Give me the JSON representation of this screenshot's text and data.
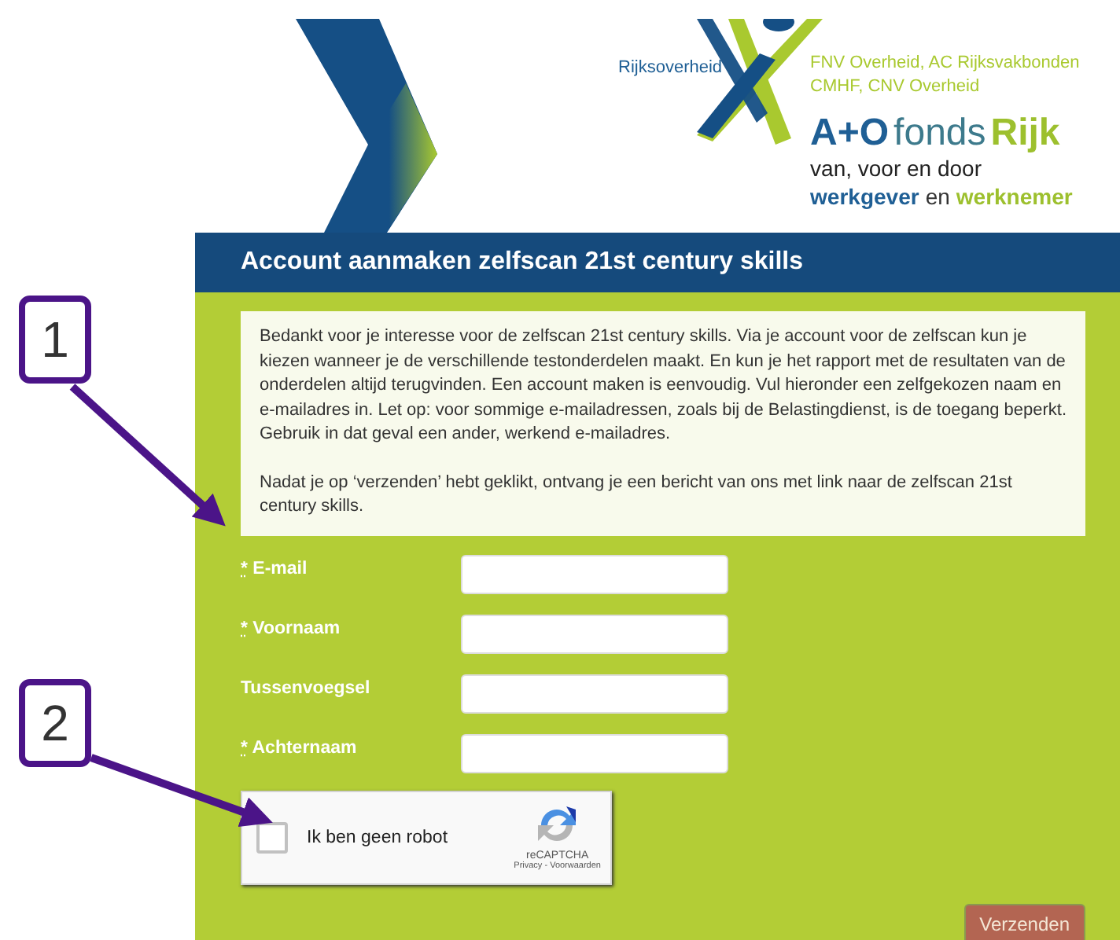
{
  "header": {
    "ministry": "Rijksoverheid",
    "unions": [
      "FNV Overheid, AC Rijksvakbonden",
      "CMHF, CNV Overheid"
    ],
    "logo_name": [
      {
        "text": "A+O",
        "color": "#1f5f95",
        "bold": true
      },
      {
        "text": "fonds",
        "color": "#3d7a8c",
        "bold": false
      },
      {
        "text": "Rijk",
        "color": "#9dc02e",
        "bold": true
      }
    ],
    "tagline": "van, voor en door",
    "tagline_2": [
      {
        "text": "werkgever",
        "color": "#1f5f95",
        "bold": true
      },
      {
        "text": "en",
        "color": "#333333",
        "bold": false
      },
      {
        "text": "werknemer",
        "color": "#9dc02e",
        "bold": true
      }
    ]
  },
  "title": "Account aanmaken zelfscan 21st century skills",
  "intro": [
    "Bedankt voor je interesse voor de zelfscan 21st century skills. Via je account voor de zelfscan kun je kiezen wanneer je de verschillende testonderdelen maakt. En kun je het rapport met de resultaten van de onderdelen altijd terugvinden. Een account maken is eenvoudig. Vul hieronder een zelfgekozen naam en e-mailadres in. Let op: voor sommige e-mailadressen, zoals bij de Belastingdienst, is de toegang beperkt. Gebruik in dat geval een ander, werkend e-mailadres.",
    "Nadat je op ‘verzenden’ hebt geklikt, ontvang je een bericht van ons met link naar de zelfscan 21st century skills."
  ],
  "required_mark": "*",
  "fields": [
    {
      "label": "E-mail",
      "required": true
    },
    {
      "label": "Voornaam",
      "required": true
    },
    {
      "label": "Tussenvoegsel",
      "required": false
    },
    {
      "label": "Achternaam",
      "required": true
    }
  ],
  "captcha": {
    "label": "Ik ben geen robot",
    "checked": false,
    "brand": "reCAPTCHA",
    "links": "Privacy - Voorwaarden"
  },
  "submit": "Verzenden",
  "callouts": [
    "1",
    "2"
  ]
}
